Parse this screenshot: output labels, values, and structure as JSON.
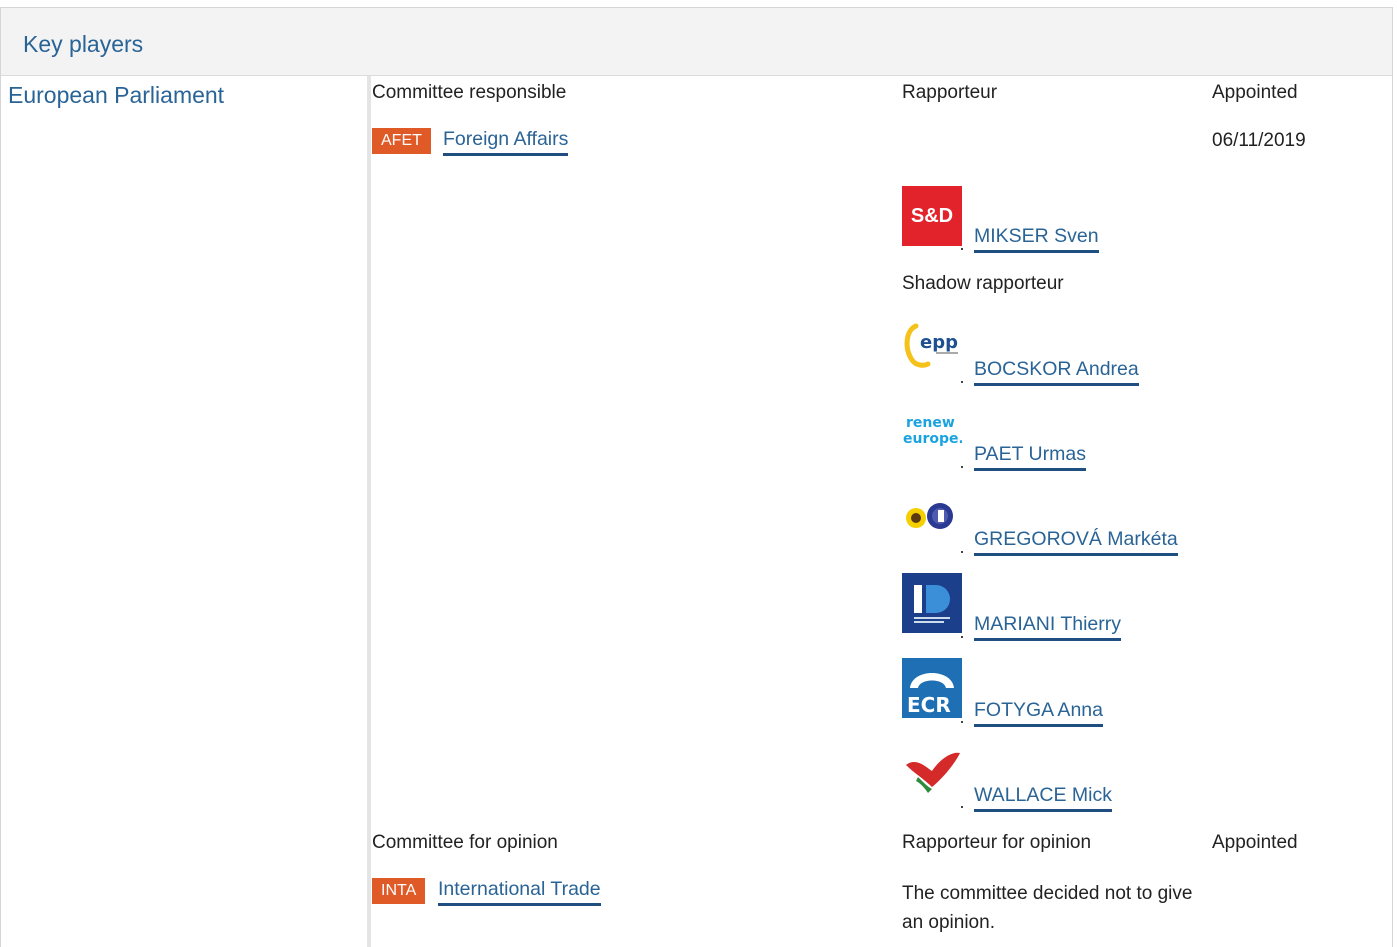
{
  "header": {
    "title": "Key players"
  },
  "institution": {
    "name": "European Parliament"
  },
  "responsible": {
    "col_committee": "Committee responsible",
    "col_rapporteur": "Rapporteur",
    "col_appointed": "Appointed",
    "committee_code": "AFET",
    "committee_name": "Foreign Affairs",
    "appointed_date": "06/11/2019",
    "rapporteur": {
      "group_logo_text": "S&D",
      "name": "MIKSER Sven"
    },
    "shadow_label": "Shadow rapporteur",
    "shadows": [
      {
        "group_logo_text": "epp",
        "name": "BOCSKOR Andrea"
      },
      {
        "group_logo_text": "renew europe.",
        "name": "PAET Urmas"
      },
      {
        "group_logo_text": "",
        "name": "GREGOROVÁ Markéta"
      },
      {
        "group_logo_text": "",
        "name": "MARIANI Thierry"
      },
      {
        "group_logo_text": "ECR",
        "name": "FOTYGA Anna"
      },
      {
        "group_logo_text": "",
        "name": "WALLACE Mick"
      }
    ]
  },
  "opinion": {
    "col_committee": "Committee for opinion",
    "col_rapporteur": "Rapporteur for opinion",
    "col_appointed": "Appointed",
    "committee_code": "INTA",
    "committee_name": "International Trade",
    "note": "The committee decided not to give an opinion."
  },
  "colors": {
    "link": "#2a6496",
    "badge": "#e05a28"
  }
}
